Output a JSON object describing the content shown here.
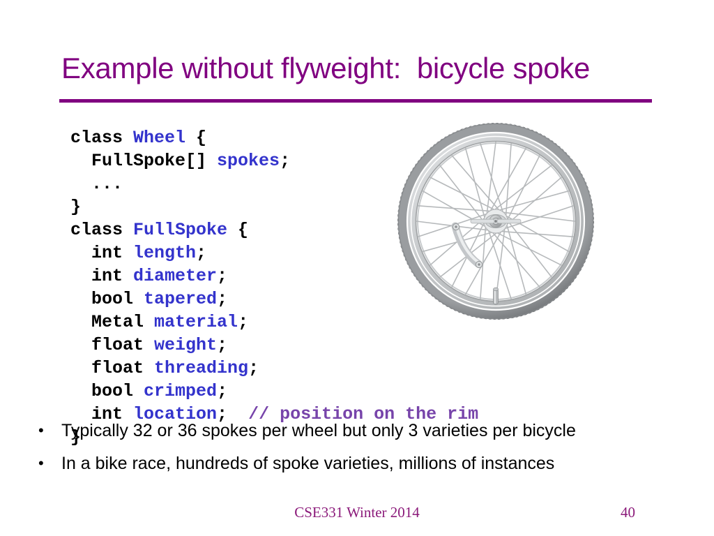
{
  "slide": {
    "title": "Example without flyweight:  bicycle spoke",
    "code": {
      "lines": [
        [
          {
            "t": "class ",
            "c": "kw"
          },
          {
            "t": "Wheel",
            "c": "id"
          },
          {
            "t": " {",
            "c": "punc"
          }
        ],
        [
          {
            "t": "  FullSpoke[] ",
            "c": "kw"
          },
          {
            "t": "spokes",
            "c": "id"
          },
          {
            "t": ";",
            "c": "punc"
          }
        ],
        [
          {
            "t": "  ...",
            "c": "punc"
          }
        ],
        [
          {
            "t": "}",
            "c": "punc"
          }
        ],
        [
          {
            "t": "class ",
            "c": "kw"
          },
          {
            "t": "FullSpoke",
            "c": "id"
          },
          {
            "t": " {",
            "c": "punc"
          }
        ],
        [
          {
            "t": "  int ",
            "c": "kw"
          },
          {
            "t": "length",
            "c": "id"
          },
          {
            "t": ";",
            "c": "punc"
          }
        ],
        [
          {
            "t": "  int ",
            "c": "kw"
          },
          {
            "t": "diameter",
            "c": "id"
          },
          {
            "t": ";",
            "c": "punc"
          }
        ],
        [
          {
            "t": "  bool ",
            "c": "kw"
          },
          {
            "t": "tapered",
            "c": "id"
          },
          {
            "t": ";",
            "c": "punc"
          }
        ],
        [
          {
            "t": "  Metal ",
            "c": "kw"
          },
          {
            "t": "material",
            "c": "id"
          },
          {
            "t": ";",
            "c": "punc"
          }
        ],
        [
          {
            "t": "  float ",
            "c": "kw"
          },
          {
            "t": "weight",
            "c": "id"
          },
          {
            "t": ";",
            "c": "punc"
          }
        ],
        [
          {
            "t": "  float ",
            "c": "kw"
          },
          {
            "t": "threading",
            "c": "id"
          },
          {
            "t": ";",
            "c": "punc"
          }
        ],
        [
          {
            "t": "  bool ",
            "c": "kw"
          },
          {
            "t": "crimped",
            "c": "id"
          },
          {
            "t": ";",
            "c": "punc"
          }
        ],
        [
          {
            "t": "  int ",
            "c": "kw"
          },
          {
            "t": "location",
            "c": "id"
          },
          {
            "t": ";  ",
            "c": "punc"
          },
          {
            "t": "// position on the rim",
            "c": "cmt"
          }
        ],
        [
          {
            "t": "}",
            "c": "punc"
          }
        ]
      ]
    },
    "figure": {
      "name": "bicycle-wheel-illustration",
      "alt": "Grey bicycle wheel with tire, rim, hub, spokes, valve stem and reflector bracket"
    },
    "bullets": [
      {
        "marker": "•",
        "text": "Typically 32 or 36 spokes per wheel but only 3 varieties per bicycle"
      },
      {
        "marker": "•",
        "text": "In a bike race, hundreds of spoke varieties, millions of instances"
      }
    ],
    "footer": {
      "course": "CSE331 Winter 2014",
      "page_number": "40"
    },
    "colors": {
      "title_purple": "#800080",
      "rule_purple": "#800080",
      "code_identifier_blue": "#3333cc",
      "code_comment_purple": "#7744aa",
      "footer_purple": "#8b1a7a",
      "body_text": "#000000",
      "background": "#ffffff",
      "wheel_tire": "#7a7d80",
      "wheel_rim": "#c9ccce",
      "wheel_spoke": "#b9bcbe"
    }
  }
}
